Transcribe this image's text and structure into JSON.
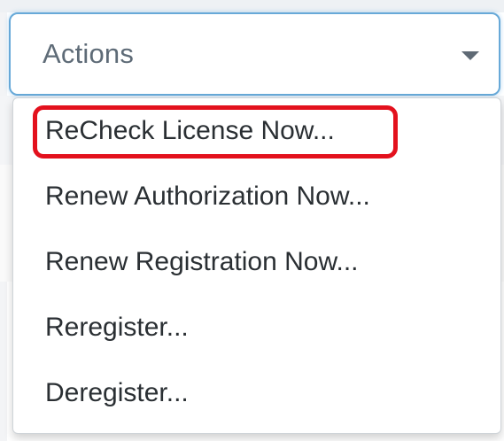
{
  "dropdown": {
    "label": "Actions",
    "caret_icon": "caret-down-icon"
  },
  "menu": {
    "items": [
      {
        "label": "ReCheck License Now..."
      },
      {
        "label": "Renew Authorization Now..."
      },
      {
        "label": "Renew Registration Now..."
      },
      {
        "label": "Reregister..."
      },
      {
        "label": "Deregister..."
      }
    ]
  },
  "colors": {
    "focus_border": "#67a9d8",
    "highlight_annotation": "#e3111d",
    "menu_text": "#2a2f33",
    "label_text": "#5e6b77"
  }
}
